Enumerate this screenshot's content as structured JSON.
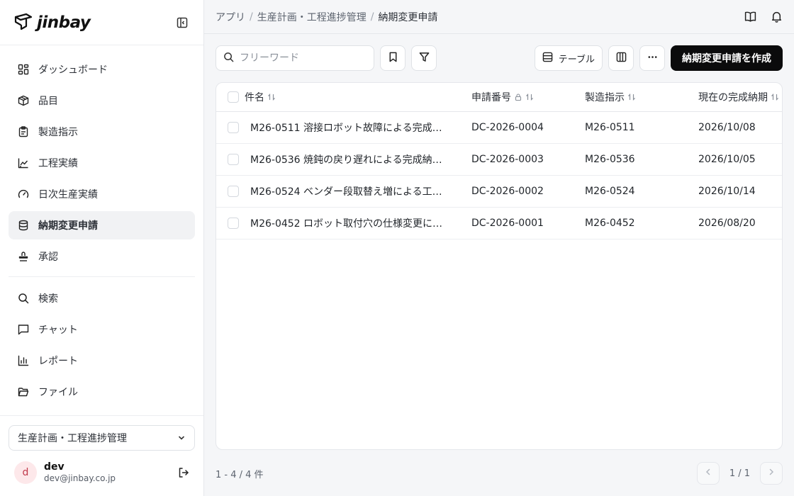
{
  "brand": {
    "name": "jinbay"
  },
  "sidebar": {
    "items": [
      {
        "label": "ダッシュボード",
        "icon": "dashboard-icon"
      },
      {
        "label": "品目",
        "icon": "box-icon"
      },
      {
        "label": "製造指示",
        "icon": "clipboard-icon"
      },
      {
        "label": "工程実績",
        "icon": "chart-icon"
      },
      {
        "label": "日次生産実績",
        "icon": "gauge-icon"
      },
      {
        "label": "納期変更申請",
        "icon": "database-icon",
        "active": true
      },
      {
        "label": "承認",
        "icon": "stamp-icon"
      }
    ],
    "secondary": [
      {
        "label": "検索",
        "icon": "search-icon"
      },
      {
        "label": "チャット",
        "icon": "chat-icon"
      },
      {
        "label": "レポート",
        "icon": "bar-chart-icon"
      },
      {
        "label": "ファイル",
        "icon": "folder-icon"
      }
    ],
    "app_selector": "生産計画・工程進捗管理",
    "user": {
      "initial": "d",
      "name": "dev",
      "email": "dev@jinbay.co.jp"
    }
  },
  "header": {
    "breadcrumb": [
      "アプリ",
      "生産計画・工程進捗管理",
      "納期変更申請"
    ]
  },
  "toolbar": {
    "search_placeholder": "フリーワード",
    "view_label": "テーブル",
    "create_label": "納期変更申請を作成"
  },
  "table": {
    "columns": [
      "件名",
      "申請番号",
      "製造指示",
      "現在の完成納期"
    ],
    "rows": [
      {
        "title": "M26-0511 溶接ロボット故障による完成納…",
        "number": "DC-2026-0004",
        "order": "M26-0511",
        "date": "2026/10/08"
      },
      {
        "title": "M26-0536 焼鈍の戻り遅れによる完成納期…",
        "number": "DC-2026-0003",
        "order": "M26-0536",
        "date": "2026/10/05"
      },
      {
        "title": "M26-0524 ベンダー段取替え増による工程…",
        "number": "DC-2026-0002",
        "order": "M26-0524",
        "date": "2026/10/14"
      },
      {
        "title": "M26-0452 ロボット取付穴の仕様変更によ…",
        "number": "DC-2026-0001",
        "order": "M26-0452",
        "date": "2026/08/20"
      }
    ]
  },
  "footer": {
    "count": "1 - 4 / 4 件",
    "page": "1 / 1"
  }
}
